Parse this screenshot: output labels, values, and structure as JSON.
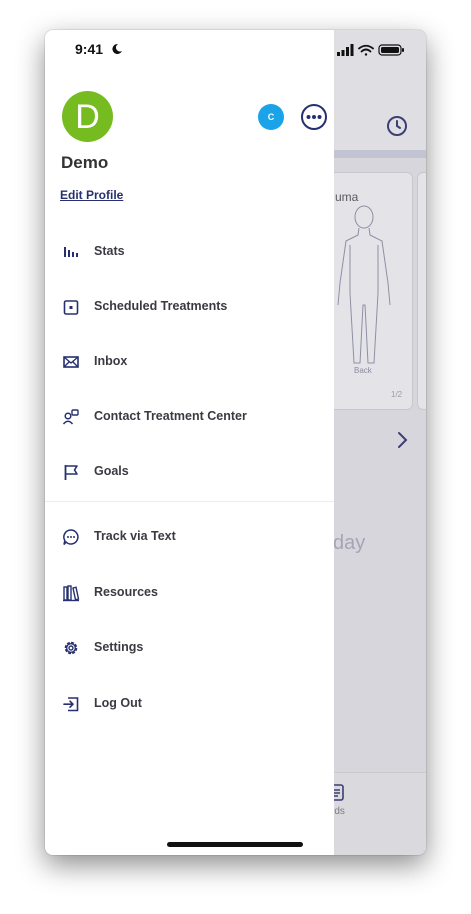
{
  "status_bar": {
    "time": "9:41"
  },
  "profile": {
    "initial": "D",
    "name": "Demo",
    "edit_label": "Edit Profile",
    "badge_letter": "C"
  },
  "menu": {
    "group1": [
      {
        "label": "Stats",
        "icon": "bar-chart-icon"
      },
      {
        "label": "Scheduled Treatments",
        "icon": "calendar-icon"
      },
      {
        "label": "Inbox",
        "icon": "envelope-icon"
      },
      {
        "label": "Contact Treatment Center",
        "icon": "contact-icon"
      },
      {
        "label": "Goals",
        "icon": "flag-icon"
      }
    ],
    "group2": [
      {
        "label": "Track via Text",
        "icon": "chat-icon"
      },
      {
        "label": "Resources",
        "icon": "books-icon"
      },
      {
        "label": "Settings",
        "icon": "gear-icon"
      },
      {
        "label": "Log Out",
        "icon": "logout-icon"
      }
    ]
  },
  "background": {
    "card_title": "uma",
    "card_back_label": "Back",
    "card_pager": "1/2",
    "day_text": "day",
    "tab_label": "rds"
  },
  "colors": {
    "avatar": "#76bc21",
    "badge": "#1aa3e8",
    "accent": "#26306f"
  }
}
